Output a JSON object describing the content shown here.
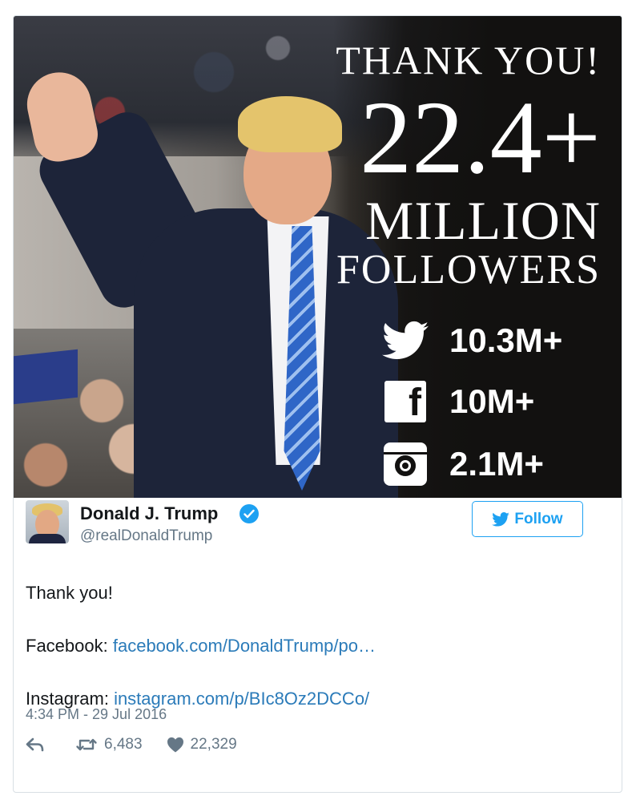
{
  "image": {
    "headline": "THANK YOU!",
    "number": "22.4+",
    "million": "MILLION",
    "followers": "FOLLOWERS",
    "stats": [
      {
        "icon": "twitter-bird-icon",
        "value": "10.3M+"
      },
      {
        "icon": "facebook-icon",
        "glyph": "f",
        "value": "10M+"
      },
      {
        "icon": "instagram-icon",
        "value": "2.1M+"
      }
    ]
  },
  "user": {
    "name": "Donald J. Trump",
    "handle": "@realDonaldTrump",
    "verified": true
  },
  "follow_button": {
    "label": "Follow"
  },
  "tweet": {
    "line1": "Thank you!",
    "facebook_label": "Facebook:",
    "facebook_link": "facebook.com/DonaldTrump/po…",
    "instagram_label": "Instagram:",
    "instagram_link": "instagram.com/p/BIc8Oz2DCCo/"
  },
  "timestamp": "4:34 PM - 29 Jul 2016",
  "actions": {
    "retweets": "6,483",
    "likes": "22,329"
  },
  "colors": {
    "twitter_blue": "#1da1f2",
    "link_blue": "#2b7bb9",
    "secondary_text": "#657786"
  }
}
